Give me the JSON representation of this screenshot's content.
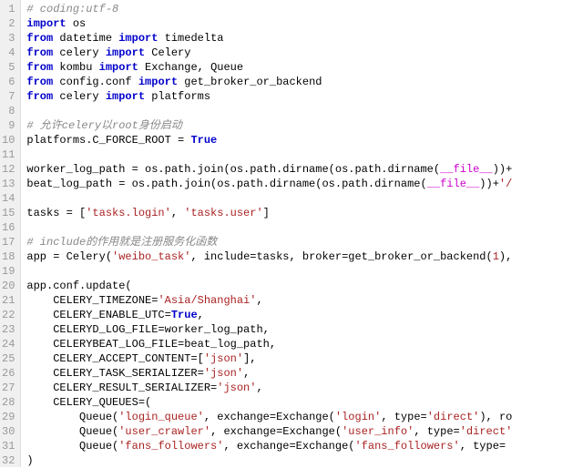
{
  "lines": [
    {
      "n": 1,
      "t": [
        {
          "c": "cm",
          "s": "# coding:utf-8"
        }
      ]
    },
    {
      "n": 2,
      "t": [
        {
          "c": "kw",
          "s": "import"
        },
        {
          "c": "nm",
          "s": " os"
        }
      ]
    },
    {
      "n": 3,
      "t": [
        {
          "c": "kw",
          "s": "from"
        },
        {
          "c": "nm",
          "s": " datetime "
        },
        {
          "c": "kw",
          "s": "import"
        },
        {
          "c": "nm",
          "s": " timedelta"
        }
      ]
    },
    {
      "n": 4,
      "t": [
        {
          "c": "kw",
          "s": "from"
        },
        {
          "c": "nm",
          "s": " celery "
        },
        {
          "c": "kw",
          "s": "import"
        },
        {
          "c": "nm",
          "s": " Celery"
        }
      ]
    },
    {
      "n": 5,
      "t": [
        {
          "c": "kw",
          "s": "from"
        },
        {
          "c": "nm",
          "s": " kombu "
        },
        {
          "c": "kw",
          "s": "import"
        },
        {
          "c": "nm",
          "s": " Exchange, Queue"
        }
      ]
    },
    {
      "n": 6,
      "t": [
        {
          "c": "kw",
          "s": "from"
        },
        {
          "c": "nm",
          "s": " config.conf "
        },
        {
          "c": "kw",
          "s": "import"
        },
        {
          "c": "nm",
          "s": " get_broker_or_backend"
        }
      ]
    },
    {
      "n": 7,
      "t": [
        {
          "c": "kw",
          "s": "from"
        },
        {
          "c": "nm",
          "s": " celery "
        },
        {
          "c": "kw",
          "s": "import"
        },
        {
          "c": "nm",
          "s": " platforms"
        }
      ]
    },
    {
      "n": 8,
      "t": []
    },
    {
      "n": 9,
      "t": [
        {
          "c": "cm",
          "s": "# 允许celery以root身份启动"
        }
      ]
    },
    {
      "n": 10,
      "t": [
        {
          "c": "nm",
          "s": "platforms.C_FORCE_ROOT = "
        },
        {
          "c": "bi",
          "s": "True"
        }
      ]
    },
    {
      "n": 11,
      "t": []
    },
    {
      "n": 12,
      "t": [
        {
          "c": "nm",
          "s": "worker_log_path = os.path.join(os.path.dirname(os.path.dirname("
        },
        {
          "c": "pa",
          "s": "__file__"
        },
        {
          "c": "nm",
          "s": "))+"
        }
      ]
    },
    {
      "n": 13,
      "t": [
        {
          "c": "nm",
          "s": "beat_log_path = os.path.join(os.path.dirname(os.path.dirname("
        },
        {
          "c": "pa",
          "s": "__file__"
        },
        {
          "c": "nm",
          "s": "))+"
        },
        {
          "c": "st",
          "s": "'/"
        }
      ]
    },
    {
      "n": 14,
      "t": []
    },
    {
      "n": 15,
      "t": [
        {
          "c": "nm",
          "s": "tasks = ["
        },
        {
          "c": "st",
          "s": "'tasks.login'"
        },
        {
          "c": "nm",
          "s": ", "
        },
        {
          "c": "st",
          "s": "'tasks.user'"
        },
        {
          "c": "nm",
          "s": "]"
        }
      ]
    },
    {
      "n": 16,
      "t": []
    },
    {
      "n": 17,
      "t": [
        {
          "c": "cm",
          "s": "# include的作用就是注册服务化函数"
        }
      ]
    },
    {
      "n": 18,
      "t": [
        {
          "c": "nm",
          "s": "app = Celery("
        },
        {
          "c": "st",
          "s": "'weibo_task'"
        },
        {
          "c": "nm",
          "s": ", include=tasks, broker=get_broker_or_backend("
        },
        {
          "c": "num",
          "s": "1"
        },
        {
          "c": "nm",
          "s": "),"
        }
      ]
    },
    {
      "n": 19,
      "t": []
    },
    {
      "n": 20,
      "t": [
        {
          "c": "nm",
          "s": "app.conf.update("
        }
      ]
    },
    {
      "n": 21,
      "t": [
        {
          "c": "nm",
          "s": "    CELERY_TIMEZONE="
        },
        {
          "c": "st",
          "s": "'Asia/Shanghai'"
        },
        {
          "c": "nm",
          "s": ","
        }
      ]
    },
    {
      "n": 22,
      "t": [
        {
          "c": "nm",
          "s": "    CELERY_ENABLE_UTC="
        },
        {
          "c": "bi",
          "s": "True"
        },
        {
          "c": "nm",
          "s": ","
        }
      ]
    },
    {
      "n": 23,
      "t": [
        {
          "c": "nm",
          "s": "    CELERYD_LOG_FILE=worker_log_path,"
        }
      ]
    },
    {
      "n": 24,
      "t": [
        {
          "c": "nm",
          "s": "    CELERYBEAT_LOG_FILE=beat_log_path,"
        }
      ]
    },
    {
      "n": 25,
      "t": [
        {
          "c": "nm",
          "s": "    CELERY_ACCEPT_CONTENT=["
        },
        {
          "c": "st",
          "s": "'json'"
        },
        {
          "c": "nm",
          "s": "],"
        }
      ]
    },
    {
      "n": 26,
      "t": [
        {
          "c": "nm",
          "s": "    CELERY_TASK_SERIALIZER="
        },
        {
          "c": "st",
          "s": "'json'"
        },
        {
          "c": "nm",
          "s": ","
        }
      ]
    },
    {
      "n": 27,
      "t": [
        {
          "c": "nm",
          "s": "    CELERY_RESULT_SERIALIZER="
        },
        {
          "c": "st",
          "s": "'json'"
        },
        {
          "c": "nm",
          "s": ","
        }
      ]
    },
    {
      "n": 28,
      "t": [
        {
          "c": "nm",
          "s": "    CELERY_QUEUES=("
        }
      ]
    },
    {
      "n": 29,
      "t": [
        {
          "c": "nm",
          "s": "        Queue("
        },
        {
          "c": "st",
          "s": "'login_queue'"
        },
        {
          "c": "nm",
          "s": ", exchange=Exchange("
        },
        {
          "c": "st",
          "s": "'login'"
        },
        {
          "c": "nm",
          "s": ", type="
        },
        {
          "c": "st",
          "s": "'direct'"
        },
        {
          "c": "nm",
          "s": "), ro"
        }
      ]
    },
    {
      "n": 30,
      "t": [
        {
          "c": "nm",
          "s": "        Queue("
        },
        {
          "c": "st",
          "s": "'user_crawler'"
        },
        {
          "c": "nm",
          "s": ", exchange=Exchange("
        },
        {
          "c": "st",
          "s": "'user_info'"
        },
        {
          "c": "nm",
          "s": ", type="
        },
        {
          "c": "st",
          "s": "'direct'"
        }
      ]
    },
    {
      "n": 31,
      "t": [
        {
          "c": "nm",
          "s": "        Queue("
        },
        {
          "c": "st",
          "s": "'fans_followers'"
        },
        {
          "c": "nm",
          "s": ", exchange=Exchange("
        },
        {
          "c": "st",
          "s": "'fans_followers'"
        },
        {
          "c": "nm",
          "s": ", type="
        }
      ]
    },
    {
      "n": 32,
      "t": [
        {
          "c": "nm",
          "s": ")"
        }
      ]
    }
  ]
}
